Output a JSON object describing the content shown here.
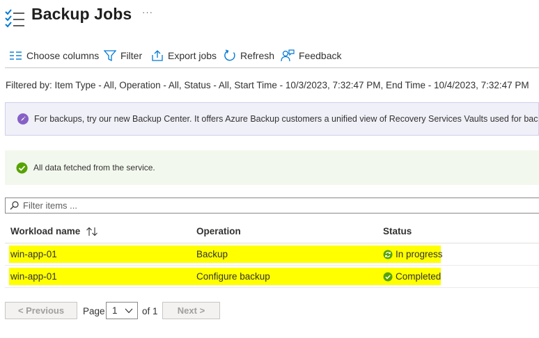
{
  "header": {
    "title": "Backup Jobs",
    "more_label": "···",
    "icon": "job-list-icon"
  },
  "toolbar": {
    "items": [
      {
        "label": "Choose columns",
        "icon": "columns-icon"
      },
      {
        "label": "Filter",
        "icon": "filter-icon"
      },
      {
        "label": "Export jobs",
        "icon": "export-icon"
      },
      {
        "label": "Refresh",
        "icon": "refresh-icon"
      },
      {
        "label": "Feedback",
        "icon": "feedback-icon"
      }
    ]
  },
  "filter_summary": "Filtered by: Item Type - All, Operation - All, Status - All, Start Time - 10/3/2023, 7:32:47 PM, End Time - 10/4/2023, 7:32:47 PM",
  "info_banner": {
    "text": "For backups, try our new Backup Center. It offers Azure Backup customers a unified view of Recovery Services Vaults used for backup in Az",
    "icon": "rocket-icon"
  },
  "success_banner": {
    "text": "All data fetched from the service.",
    "icon": "success-check-icon"
  },
  "search": {
    "placeholder": "Filter items ...",
    "value": ""
  },
  "table": {
    "columns": [
      "Workload name",
      "Operation",
      "Status"
    ],
    "rows": [
      {
        "workload": "win-app-01",
        "operation": "Backup",
        "status": "In progress",
        "status_icon": "in-progress-icon"
      },
      {
        "workload": "win-app-01",
        "operation": "Configure backup",
        "status": "Completed",
        "status_icon": "completed-icon"
      }
    ]
  },
  "pager": {
    "previous_label": "< Previous",
    "page_label": "Page",
    "current_page": "1",
    "of_label": "of 1",
    "next_label": "Next >"
  },
  "colors": {
    "accent": "#0078d4",
    "success": "#57a300",
    "highlight": "#ffff00",
    "info_purple": "#8661c5"
  }
}
